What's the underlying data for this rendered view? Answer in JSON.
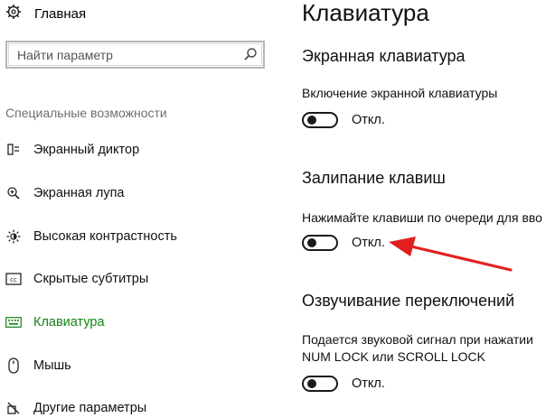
{
  "sidebar": {
    "home_label": "Главная",
    "search_placeholder": "Найти параметр",
    "section_label": "Специальные возможности",
    "items": [
      {
        "label": "Экранный диктор",
        "icon": "narrator-icon"
      },
      {
        "label": "Экранная лупа",
        "icon": "magnifier-icon"
      },
      {
        "label": "Высокая контрастность",
        "icon": "high-contrast-icon"
      },
      {
        "label": "Скрытые субтитры",
        "icon": "closed-captions-icon"
      },
      {
        "label": "Клавиатура",
        "icon": "keyboard-icon",
        "active": true
      },
      {
        "label": "Мышь",
        "icon": "mouse-icon"
      },
      {
        "label": "Другие параметры",
        "icon": "other-options-icon"
      }
    ]
  },
  "content": {
    "title": "Клавиатура",
    "sections": [
      {
        "heading": "Экранная клавиатура",
        "description": "Включение экранной клавиатуры",
        "state": "Откл.",
        "on": false
      },
      {
        "heading": "Залипание клавиш",
        "description": "Нажимайте клавиши по очереди для вво",
        "state": "Откл.",
        "on": false
      },
      {
        "heading": "Озвучивание переключений",
        "description_lines": [
          "Подается звуковой сигнал при нажатии",
          "NUM LOCK или SCROLL LOCK"
        ],
        "state": "Откл.",
        "on": false
      }
    ]
  },
  "colors": {
    "accent": "#108410",
    "annotation_arrow": "#e02020"
  }
}
